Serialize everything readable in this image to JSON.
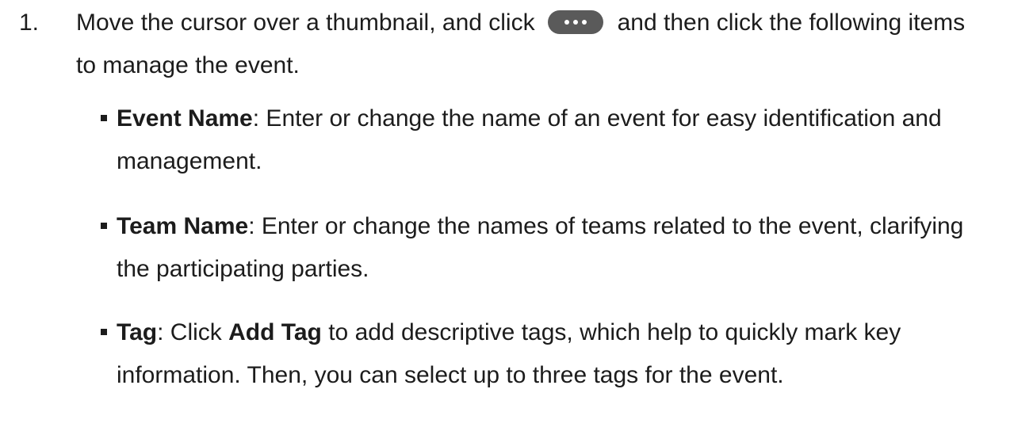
{
  "step": {
    "number": "1.",
    "text_before_icon": "Move the cursor over a thumbnail, and click",
    "icon": "more-options-icon",
    "text_after_icon": "and then click the following items to manage the event."
  },
  "items": [
    {
      "term": "Event Name",
      "separator": ":",
      "description": " Enter or change the name of an event for easy identification and management."
    },
    {
      "term": "Team Name",
      "separator": ":",
      "description": " Enter or change the names of teams related to the event, clarifying the participating parties."
    },
    {
      "term": "Tag",
      "separator": ":",
      "description_before": " Click ",
      "action": "Add Tag",
      "description_after": " to add descriptive tags, which help to quickly mark key information. Then, you can select up to three tags for the event."
    }
  ]
}
